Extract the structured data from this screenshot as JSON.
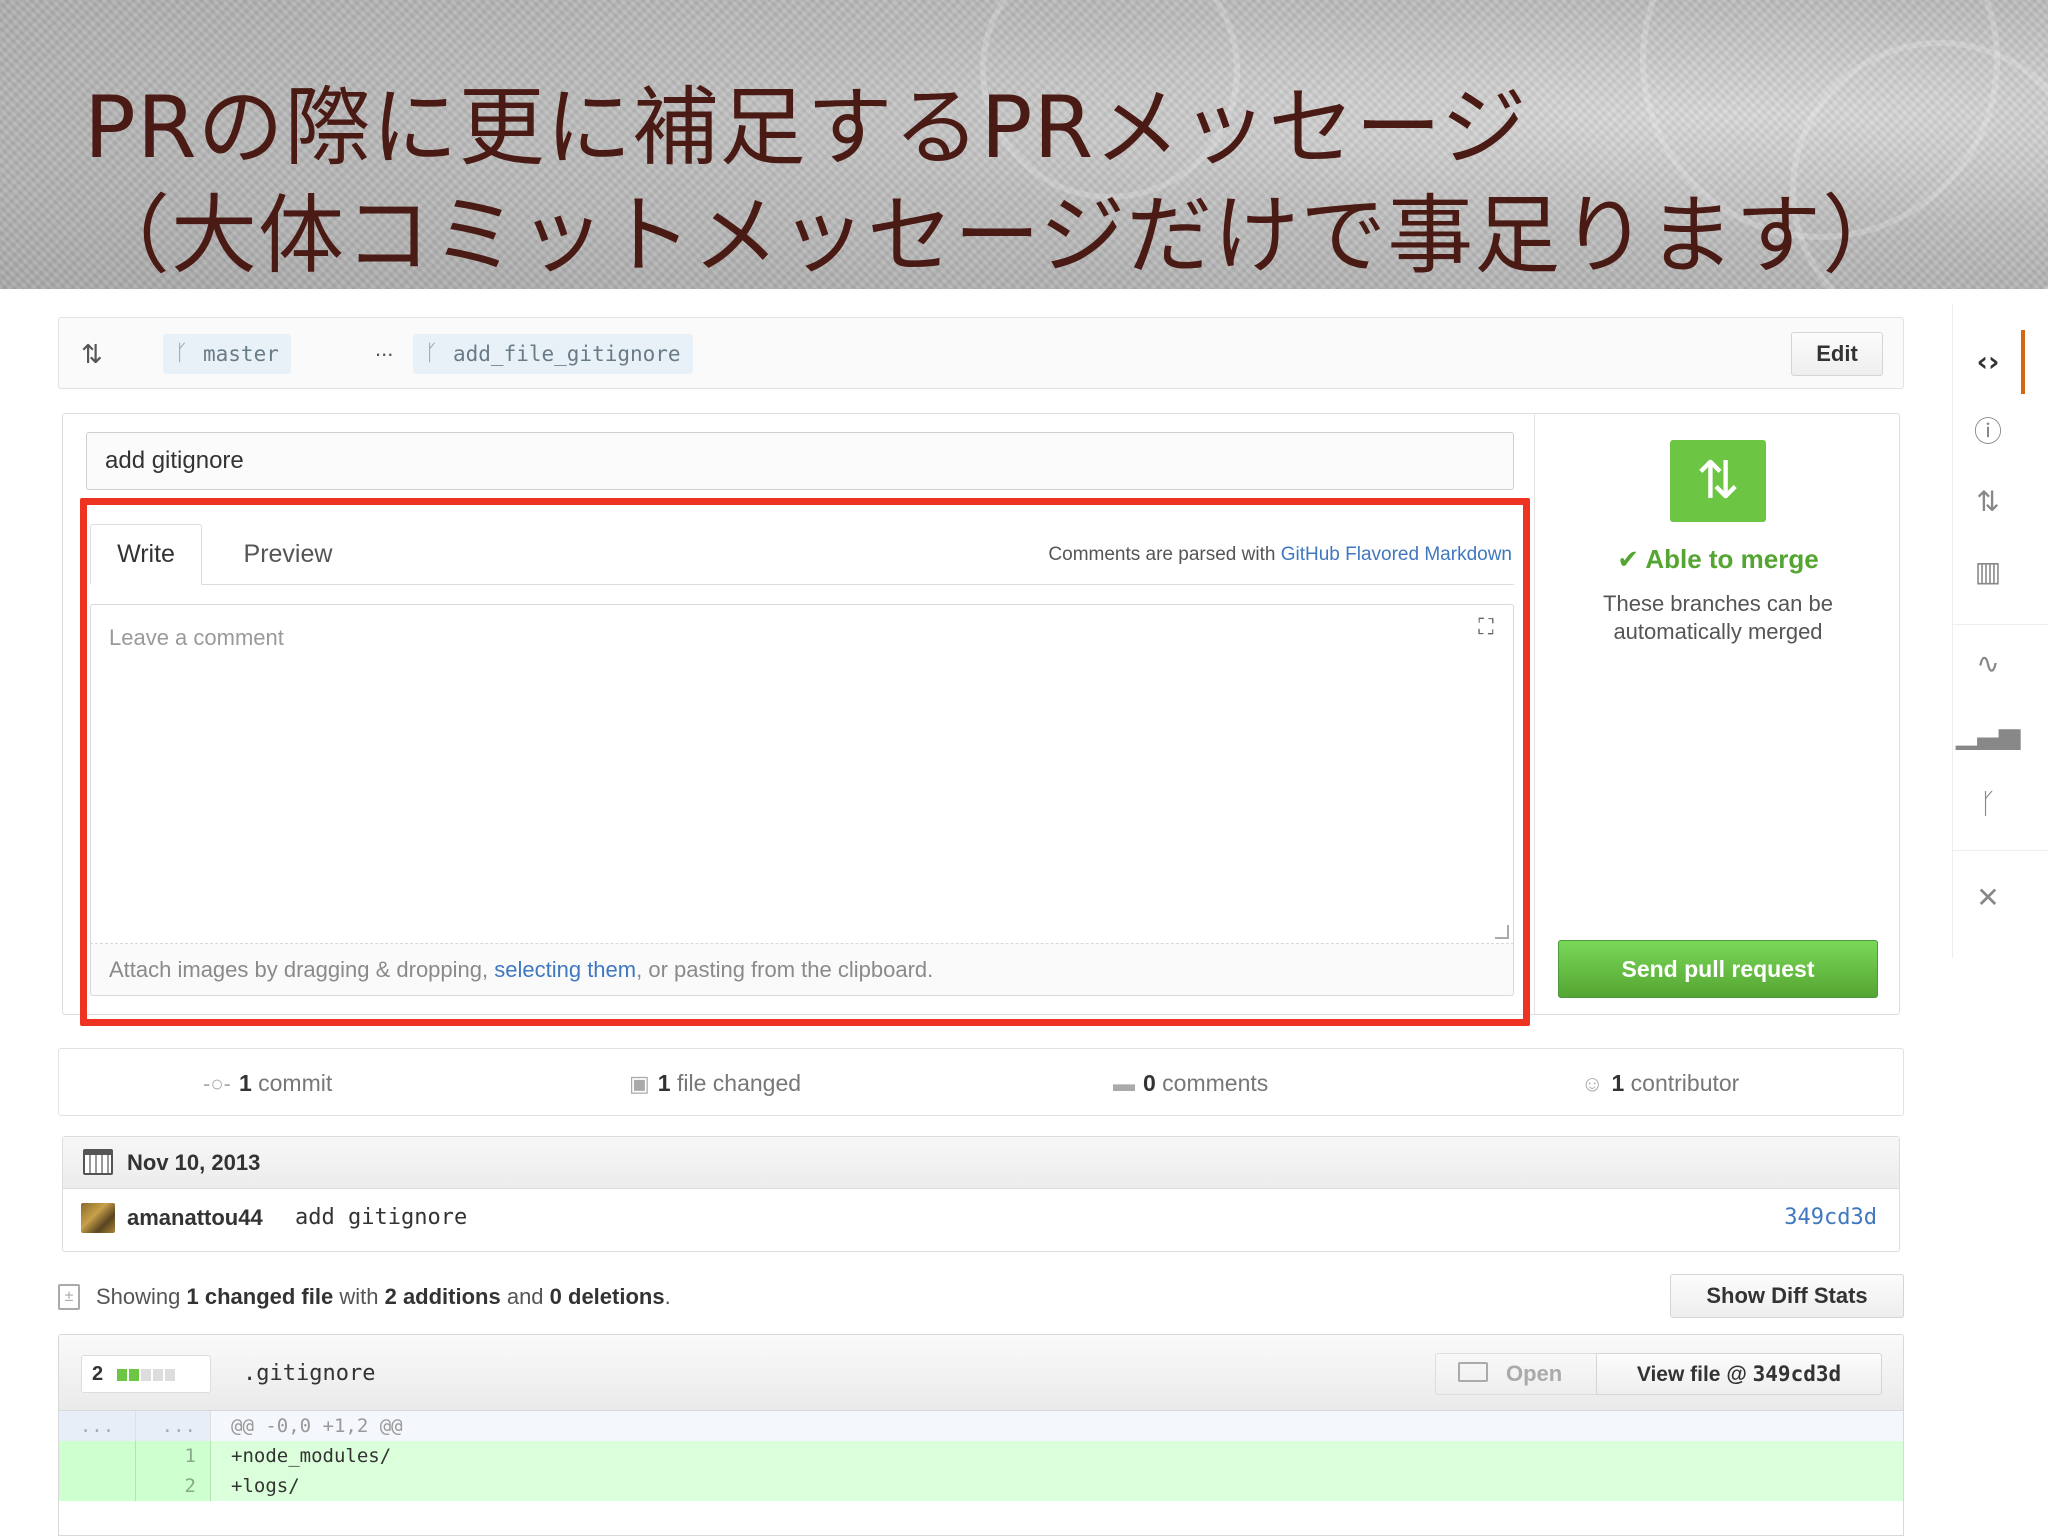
{
  "banner": {
    "line1": "PRの際に更に補足するPRメッセージ",
    "line2": "（大体コミットメッセージだけで事足ります）"
  },
  "compare": {
    "icon": "compare-icon",
    "base_branch": "master",
    "separator": "...",
    "head_branch": "add_file_gitignore",
    "edit_label": "Edit"
  },
  "form": {
    "title_value": "add gitignore",
    "tab_write": "Write",
    "tab_preview": "Preview",
    "md_note_prefix": "Comments are parsed with ",
    "md_note_link": "GitHub Flavored Markdown",
    "comment_placeholder": "Leave a comment",
    "attach_prefix": "Attach images by dragging & dropping, ",
    "attach_link": "selecting them",
    "attach_suffix": ", or pasting from the clipboard.",
    "highlight_color": "#ee3322"
  },
  "merge": {
    "status": "✔ Able to merge",
    "description": "These branches can be automatically merged",
    "send_label": "Send pull request",
    "accent": "#6cc644"
  },
  "stats": {
    "commits_count": "1",
    "commits_label": " commit",
    "files_count": "1",
    "files_label": " file changed",
    "comments_count": "0",
    "comments_label": " comments",
    "contributors_count": "1",
    "contributors_label": " contributor"
  },
  "commits": {
    "date": "Nov 10, 2013",
    "author": "amanattou44",
    "message": "add gitignore",
    "sha": "349cd3d"
  },
  "summary": {
    "showing": "Showing ",
    "changed_count": "1 changed file",
    "with": " with ",
    "additions": "2 additions",
    "and": " and ",
    "deletions": "0 deletions",
    "end": ".",
    "diff_stats_label": "Show Diff Stats"
  },
  "file": {
    "count": "2",
    "name": ".gitignore",
    "open_label": "Open",
    "view_label": "View file @ ",
    "view_sha": "349cd3d",
    "hunk_ln1": "...",
    "hunk_ln2": "...",
    "hunk": "@@ -0,0 +1,2 @@",
    "lines": [
      {
        "num": "1",
        "code": "+node_modules/"
      },
      {
        "num": "2",
        "code": "+logs/"
      }
    ]
  },
  "rnav": {
    "items": [
      "code-icon",
      "issues-icon",
      "pull-requests-icon",
      "wiki-icon",
      "pulse-icon",
      "graphs-icon",
      "network-icon",
      "settings-icon"
    ]
  }
}
